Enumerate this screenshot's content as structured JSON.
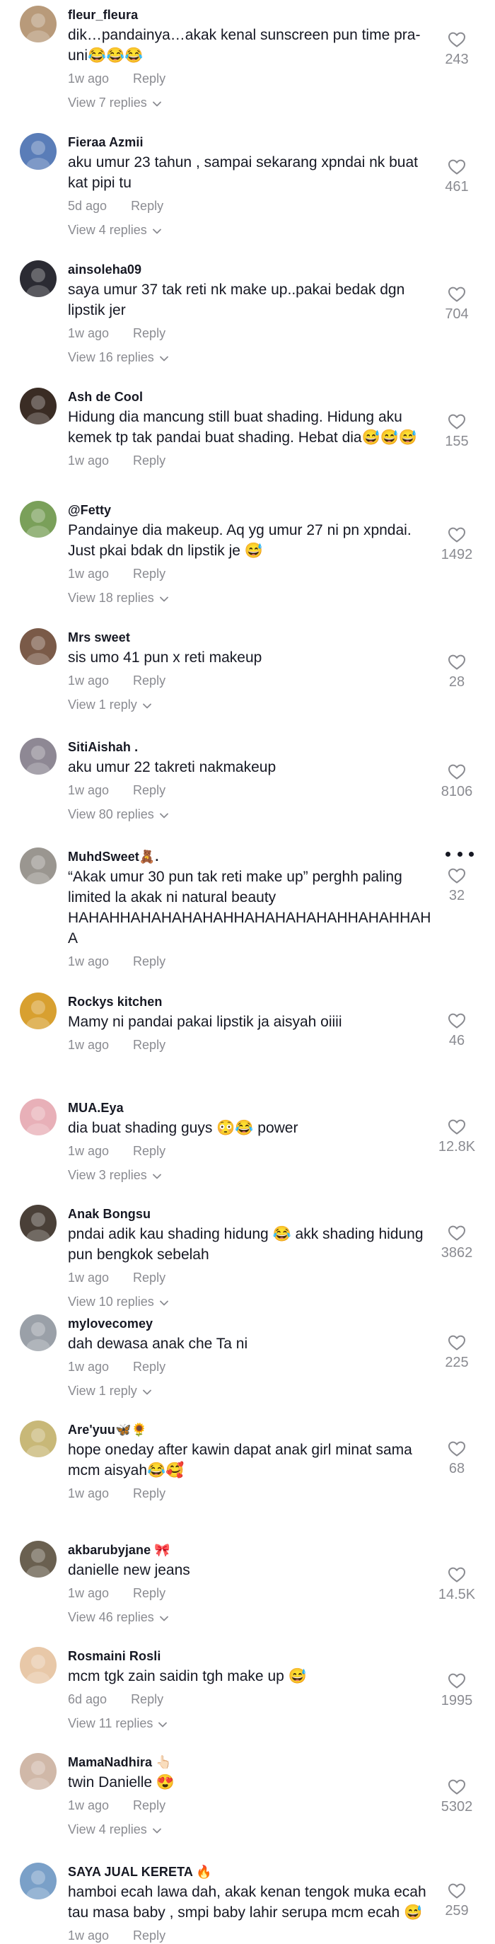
{
  "comments": [
    {
      "username": "fleur_fleura",
      "text": "dik…pandainya…akak kenal sunscreen pun time pra-uni😂😂😂",
      "time": "1w ago",
      "reply": "Reply",
      "view_replies": "View 7 replies",
      "likes": "243"
    },
    {
      "username": "Fieraa Azmii",
      "text": "aku umur 23 tahun , sampai sekarang xpndai nk buat kat pipi tu",
      "time": "5d ago",
      "reply": "Reply",
      "view_replies": "View 4 replies",
      "likes": "461"
    },
    {
      "username": "ainsoleha09",
      "text": "saya umur 37 tak reti nk make up..pakai bedak dgn lipstik jer",
      "time": "1w ago",
      "reply": "Reply",
      "view_replies": "View 16 replies",
      "likes": "704"
    },
    {
      "username": "Ash de Cool",
      "text": "Hidung dia mancung still buat shading. Hidung aku kemek tp tak pandai buat shading. Hebat dia😅😅😅",
      "time": "1w ago",
      "reply": "Reply",
      "view_replies": "",
      "likes": "155"
    },
    {
      "username": "@Fetty",
      "text": "Pandainye dia makeup. Aq yg umur 27 ni pn xpndai. Just pkai bdak dn lipstik je 😅",
      "time": "1w ago",
      "reply": "Reply",
      "view_replies": "View 18 replies",
      "likes": "1492"
    },
    {
      "username": "Mrs sweet",
      "text": "sis umo 41 pun x reti makeup",
      "time": "1w ago",
      "reply": "Reply",
      "view_replies": "View 1 reply",
      "likes": "28"
    },
    {
      "username": "SitiAishah .",
      "text": "aku umur 22 takreti nakmakeup",
      "time": "1w ago",
      "reply": "Reply",
      "view_replies": "View 80 replies",
      "likes": "8106"
    },
    {
      "username": "MuhdSweet🧸.",
      "text": "“Akak umur 30 pun tak reti make up” perghh paling limited la akak ni natural beauty HAHAHHAHAHAHAHAHHAHAHAHAHAHHAHAHHAHA",
      "time": "1w ago",
      "reply": "Reply",
      "view_replies": "",
      "likes": "32"
    },
    {
      "username": "Rockys kitchen",
      "text": "Mamy ni pandai pakai lipstik ja aisyah oiiii",
      "time": "1w ago",
      "reply": "Reply",
      "view_replies": "",
      "likes": "46"
    },
    {
      "username": "MUA.Eya",
      "text": "dia buat shading guys 😳😂 power",
      "time": "1w ago",
      "reply": "Reply",
      "view_replies": "View 3 replies",
      "likes": "12.8K"
    },
    {
      "username": "Anak Bongsu",
      "text": "pndai adik kau shading hidung 😂 akk shading hidung pun bengkok sebelah",
      "time": "1w ago",
      "reply": "Reply",
      "view_replies": "View 10 replies",
      "likes": "3862"
    },
    {
      "username": "mylovecomey",
      "text": "dah dewasa anak che Ta ni",
      "time": "1w ago",
      "reply": "Reply",
      "view_replies": "View 1 reply",
      "likes": "225"
    },
    {
      "username": "Are'yuu🦋🌻",
      "text": "hope oneday after kawin dapat anak girl minat sama mcm aisyah😂🥰",
      "time": "1w ago",
      "reply": "Reply",
      "view_replies": "",
      "likes": "68"
    },
    {
      "username": "akbarubyjane 🎀",
      "text": "danielle new jeans",
      "time": "1w ago",
      "reply": "Reply",
      "view_replies": "View 46 replies",
      "likes": "14.5K"
    },
    {
      "username": "Rosmaini Rosli",
      "text": "mcm tgk zain saidin tgh make up 😅",
      "time": "6d ago",
      "reply": "Reply",
      "view_replies": "View 11 replies",
      "likes": "1995"
    },
    {
      "username": "MamaNadhira 👆🏻",
      "text": "twin Danielle 😍",
      "time": "1w ago",
      "reply": "Reply",
      "view_replies": "View 4 replies",
      "likes": "5302"
    },
    {
      "username": "SAYA JUAL KERETA 🔥",
      "text": "hamboi ecah lawa dah, akak kenan tengok muka ecah tau masa baby , smpi baby lahir serupa mcm ecah 😅",
      "time": "1w ago",
      "reply": "Reply",
      "view_replies": "",
      "likes": "259"
    }
  ],
  "colors": {
    "text": "#161823",
    "muted": "#8a8b91",
    "avatars": [
      "#b89a7a",
      "#5a7db8",
      "#2b2b33",
      "#3a2c24",
      "#7aa05a",
      "#7a5a48",
      "#8e8894",
      "#9a9690",
      "#d8a030",
      "#e8b0b8",
      "#4a4038",
      "#9aa0a8",
      "#c8b878",
      "#6a6050",
      "#e8c8a8",
      "#d0b8a8",
      "#7aa0c8"
    ]
  },
  "icons": {
    "like": "heart-outline-icon",
    "expand": "chevron-down-icon",
    "menu": "more-dots-icon"
  }
}
